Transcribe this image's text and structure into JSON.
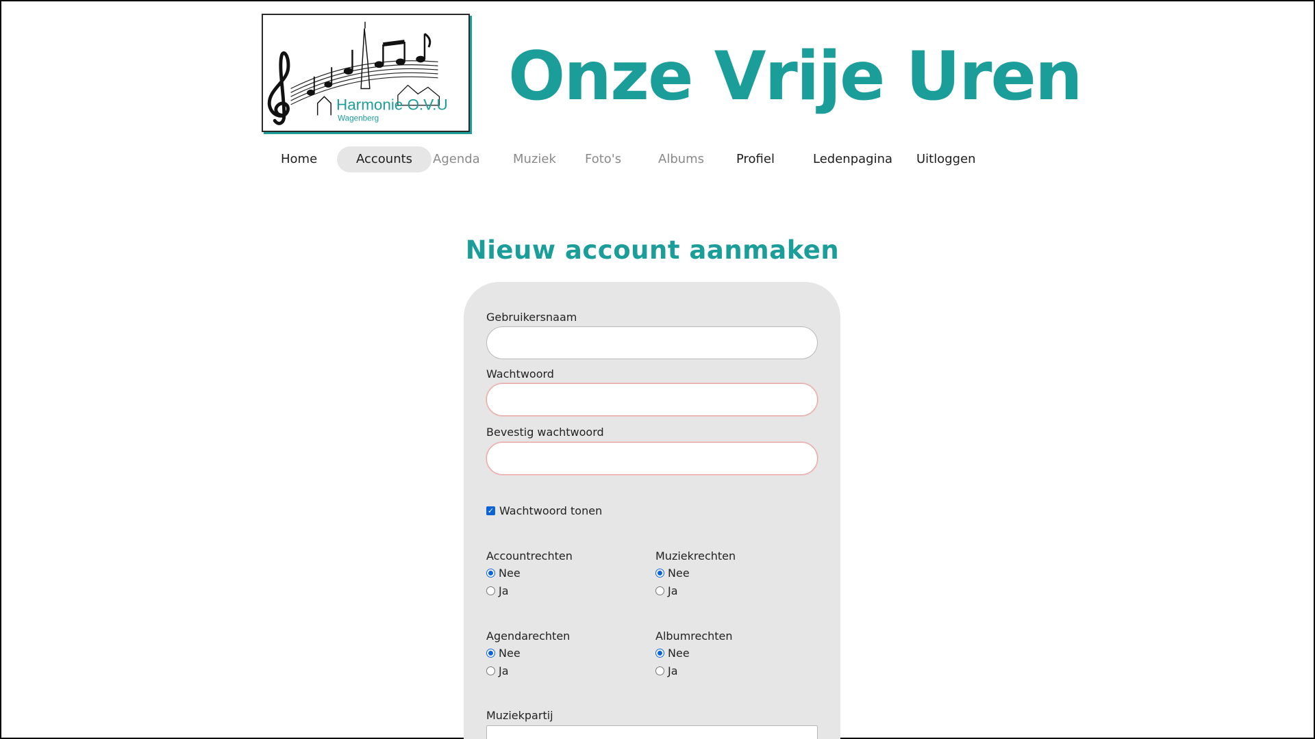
{
  "header": {
    "logo_text": "Harmonie O.V.U",
    "logo_subtext": "Wagenberg",
    "site_title": "Onze Vrije Uren"
  },
  "nav": {
    "items": [
      {
        "label": "Home",
        "state": "normal"
      },
      {
        "label": "Accounts",
        "state": "active"
      },
      {
        "label": "Agenda",
        "state": "disabled"
      },
      {
        "label": "Muziek",
        "state": "disabled"
      },
      {
        "label": "Foto's",
        "state": "disabled"
      },
      {
        "label": "Albums",
        "state": "disabled"
      },
      {
        "label": "Profiel",
        "state": "normal"
      },
      {
        "label": "Ledenpagina",
        "state": "normal"
      },
      {
        "label": "Uitloggen",
        "state": "normal"
      }
    ]
  },
  "form": {
    "heading": "Nieuw account aanmaken",
    "username_label": "Gebruikersnaam",
    "username_value": "",
    "password_label": "Wachtwoord",
    "password_value": "",
    "confirm_label": "Bevestig wachtwoord",
    "confirm_value": "",
    "show_password_label": "Wachtwoord tonen",
    "show_password_checked": true,
    "rights": [
      {
        "label": "Accountrechten",
        "selected": "Nee",
        "options": [
          "Nee",
          "Ja"
        ]
      },
      {
        "label": "Muziekrechten",
        "selected": "Nee",
        "options": [
          "Nee",
          "Ja"
        ]
      },
      {
        "label": "Agendarechten",
        "selected": "Nee",
        "options": [
          "Nee",
          "Ja"
        ]
      },
      {
        "label": "Albumrechten",
        "selected": "Nee",
        "options": [
          "Nee",
          "Ja"
        ]
      }
    ],
    "music_part_label": "Muziekpartij"
  },
  "colors": {
    "accent": "#1b9e9a",
    "radio_blue": "#0b63d6",
    "card_bg": "#e6e6e6"
  }
}
